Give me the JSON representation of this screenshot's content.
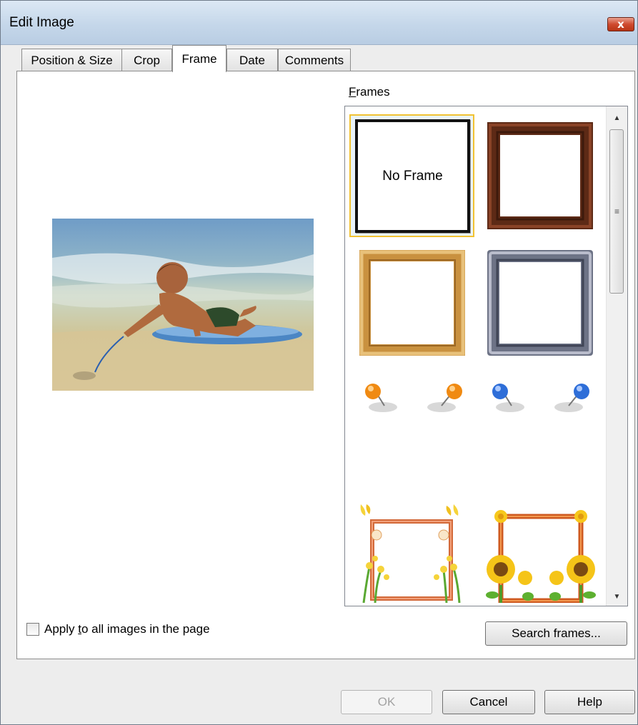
{
  "window": {
    "title": "Edit Image",
    "close_glyph": "x"
  },
  "tabs": [
    {
      "label": "Position & Size",
      "active": false
    },
    {
      "label": "Crop",
      "active": false
    },
    {
      "label": "Frame",
      "active": true
    },
    {
      "label": "Date",
      "active": false
    },
    {
      "label": "Comments",
      "active": false
    }
  ],
  "frames": {
    "label_prefix": "F",
    "label_rest": "rames",
    "items": [
      {
        "name": "No Frame",
        "text": "No Frame",
        "selected": true
      },
      {
        "name": "dark-wood-frame"
      },
      {
        "name": "light-wood-frame"
      },
      {
        "name": "silver-frame"
      },
      {
        "name": "orange-pins"
      },
      {
        "name": "blue-pins"
      },
      {
        "name": "butterfly-flower-frame"
      },
      {
        "name": "sunflower-frame"
      }
    ],
    "scrollbar": {
      "up_icon": "▲",
      "down_icon": "▼",
      "grip": "≡"
    }
  },
  "apply_all": {
    "label_pre": "Apply ",
    "label_accel": "t",
    "label_post": "o all images in the page",
    "checked": false
  },
  "buttons": {
    "search": "Search frames...",
    "ok": "OK",
    "cancel": "Cancel",
    "help": "Help"
  },
  "colors": {
    "selection_border": "#f1c232",
    "titlebar": "#c5d7ea",
    "close_button": "#cf4a2f"
  }
}
